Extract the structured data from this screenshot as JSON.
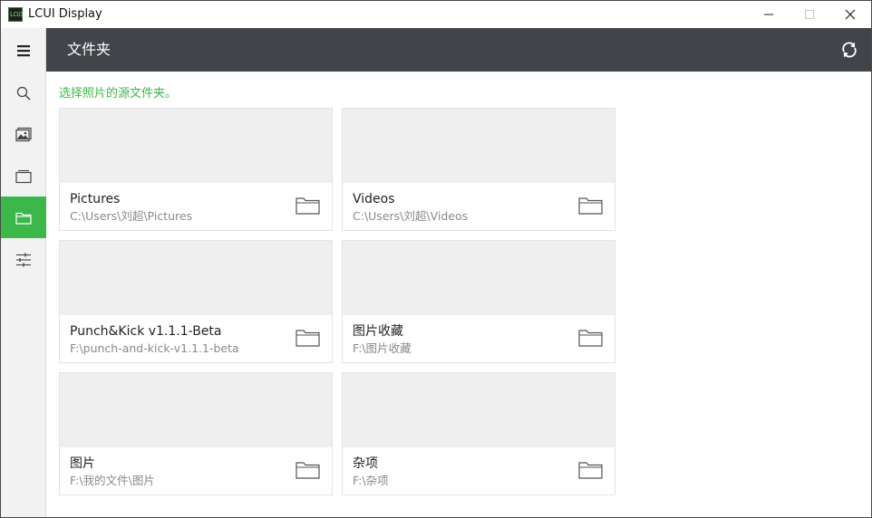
{
  "window": {
    "app_icon_text": "LCUI",
    "title": "LCUI Display"
  },
  "sidebar": {
    "items": [
      {
        "icon": "menu-icon",
        "active": false
      },
      {
        "icon": "search-icon",
        "active": false
      },
      {
        "icon": "photos-icon",
        "active": false
      },
      {
        "icon": "albums-icon",
        "active": false
      },
      {
        "icon": "folder-icon",
        "active": true
      },
      {
        "icon": "settings-sliders-icon",
        "active": false
      }
    ]
  },
  "header": {
    "title": "文件夹",
    "refresh_icon": "refresh-icon"
  },
  "main": {
    "hint": "选择照片的源文件夹。",
    "folders": [
      {
        "name": "Pictures",
        "path": "C:\\Users\\刘超\\Pictures"
      },
      {
        "name": "Videos",
        "path": "C:\\Users\\刘超\\Videos"
      },
      {
        "name": "Punch&Kick  v1.1.1-Beta",
        "path": "F:\\punch-and-kick-v1.1.1-beta"
      },
      {
        "name": "图片收藏",
        "path": "F:\\图片收藏"
      },
      {
        "name": "图片",
        "path": "F:\\我的文件\\图片"
      },
      {
        "name": "杂项",
        "path": "F:\\杂项"
      }
    ]
  },
  "colors": {
    "accent": "#3cb84a",
    "header_bg": "#414549",
    "sidebar_bg": "#f2f2f2",
    "thumb_bg": "#efefef"
  }
}
